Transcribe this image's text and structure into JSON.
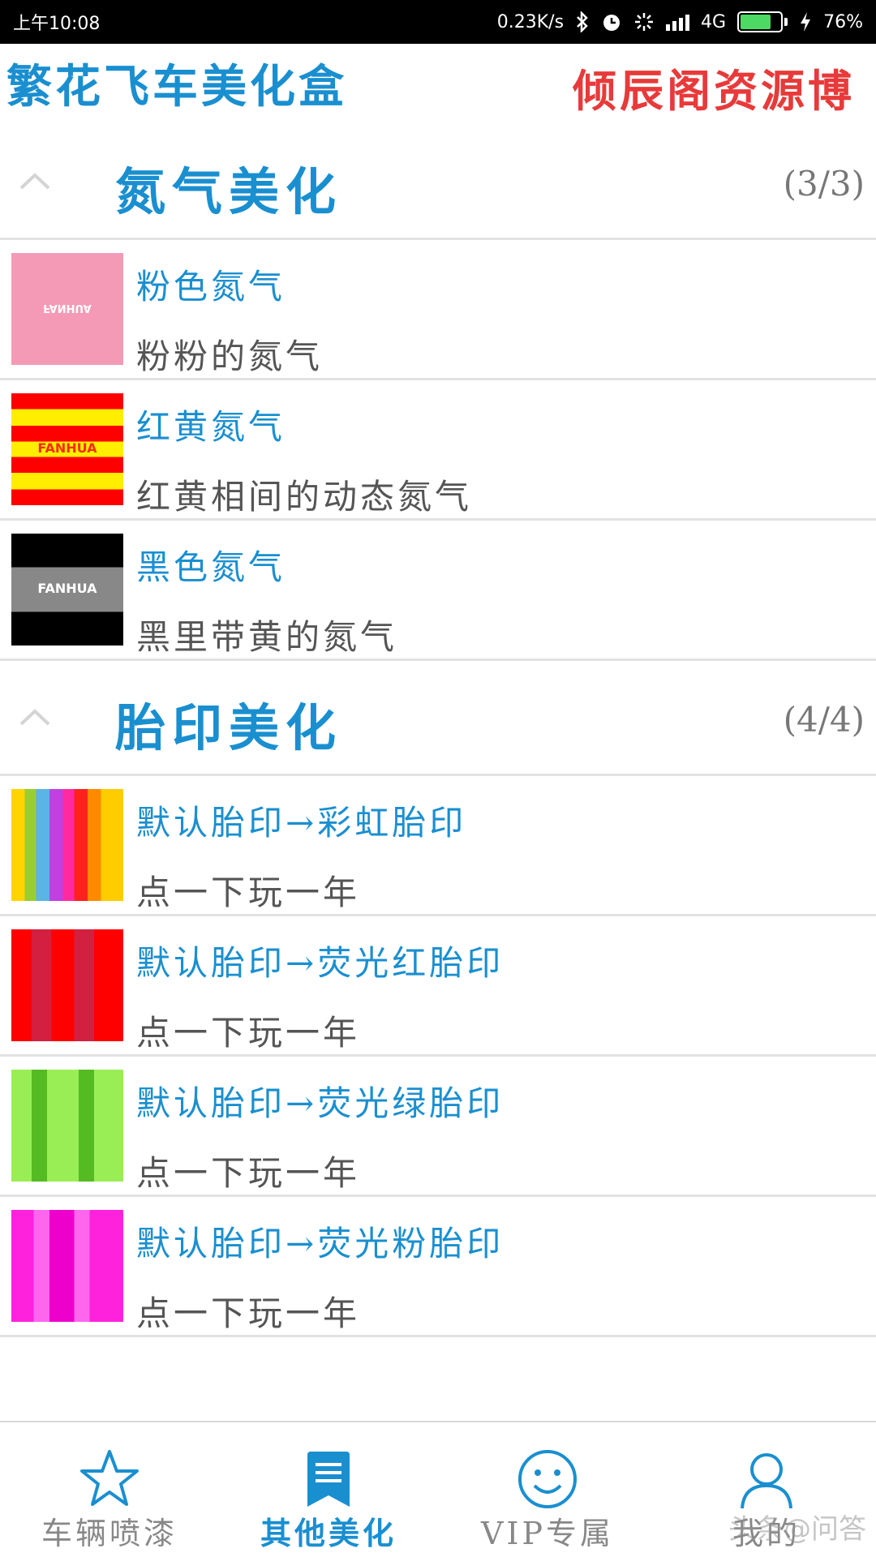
{
  "status_bar": {
    "time": "上午10:08",
    "net_speed": "0.23K/s",
    "network": "4G",
    "battery_percent": "76%",
    "battery_level": 0.76,
    "icons": [
      "bluetooth-icon",
      "alarm-icon",
      "loading-icon",
      "signal-icon",
      "battery-icon",
      "charging-icon"
    ]
  },
  "header": {
    "left_title": "繁花飞车美化盒",
    "right_title": "倾辰阁资源博"
  },
  "groups": [
    {
      "title": "氮气美化",
      "count": "(3/3)",
      "items": [
        {
          "title": "粉色氮气",
          "desc": "粉粉的氮气",
          "thumb_label": "FANHUA"
        },
        {
          "title": "红黄氮气",
          "desc": "红黄相间的动态氮气",
          "thumb_label": "FANHUA"
        },
        {
          "title": "黑色氮气",
          "desc": "黑里带黄的氮气",
          "thumb_label": "FANHUA"
        }
      ]
    },
    {
      "title": "胎印美化",
      "count": "(4/4)",
      "items": [
        {
          "title": "默认胎印→彩虹胎印",
          "desc": "点一下玩一年"
        },
        {
          "title": "默认胎印→荧光红胎印",
          "desc": "点一下玩一年"
        },
        {
          "title": "默认胎印→荧光绿胎印",
          "desc": "点一下玩一年"
        },
        {
          "title": "默认胎印→荧光粉胎印",
          "desc": "点一下玩一年"
        }
      ]
    }
  ],
  "bottom_nav": {
    "items": [
      {
        "label": "车辆喷漆",
        "icon": "star-icon"
      },
      {
        "label": "其他美化",
        "icon": "bookmark-icon",
        "active": true
      },
      {
        "label": "VIP专属",
        "icon": "smiley-icon"
      },
      {
        "label": "我的",
        "icon": "user-icon"
      }
    ],
    "watermark": "头条@问答"
  },
  "colors": {
    "accent": "#1a8fd0",
    "header_right": "#e83a3a",
    "status_bar_bg": "#000000",
    "battery_fill": "#4cd964"
  }
}
